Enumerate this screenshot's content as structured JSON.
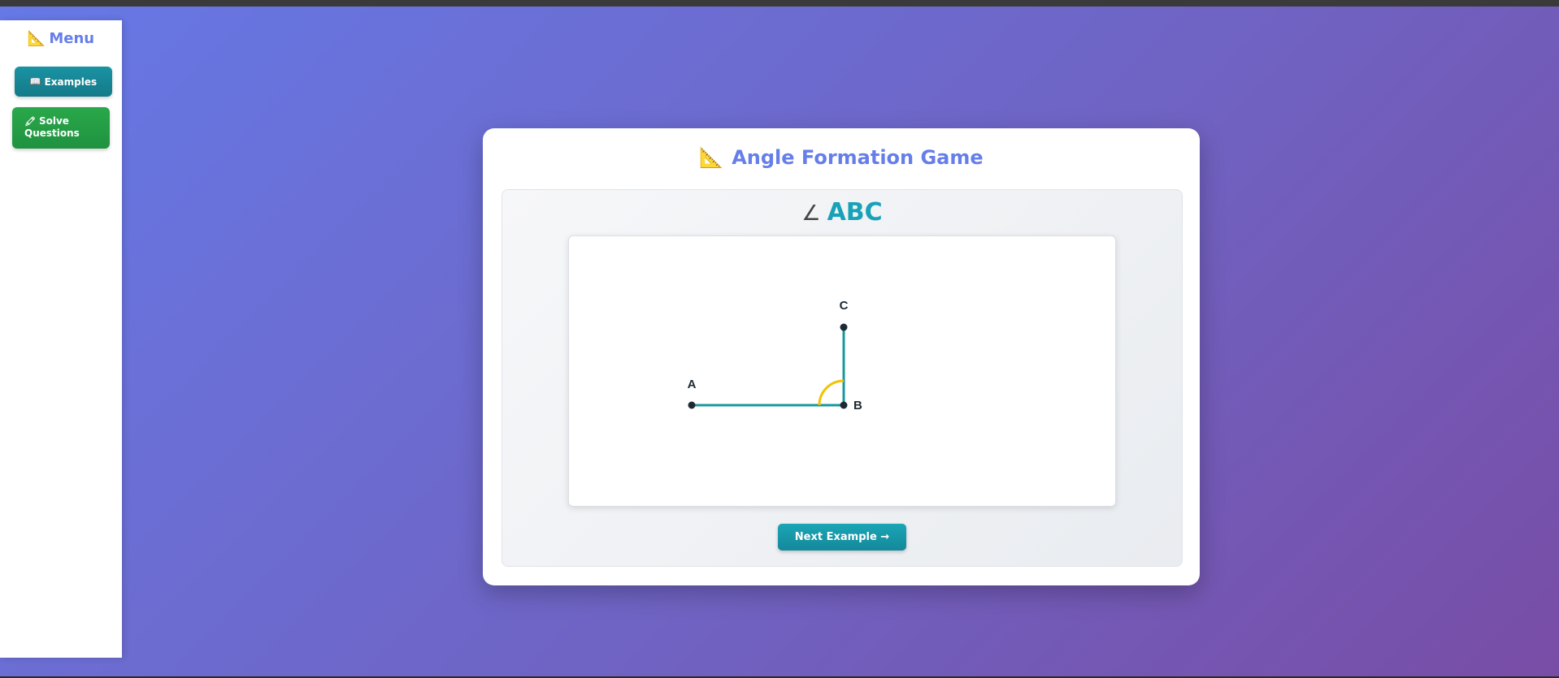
{
  "sidebar": {
    "title": "Menu",
    "title_icon": "📐",
    "items": [
      {
        "label": "Examples",
        "icon": "📖"
      },
      {
        "label": "Solve",
        "label_line2": "Questions",
        "icon": "🖍"
      }
    ]
  },
  "game": {
    "title": "Angle Formation Game",
    "title_icon": "📐",
    "angle_symbol": "∠",
    "angle_name": "ABC",
    "points": {
      "a": "A",
      "b": "B",
      "c": "C"
    },
    "next_button": "Next Example →"
  },
  "colors": {
    "ray": "#17979e",
    "arc": "#f2c200",
    "point": "#1e2a33",
    "accent": "#667eea"
  }
}
